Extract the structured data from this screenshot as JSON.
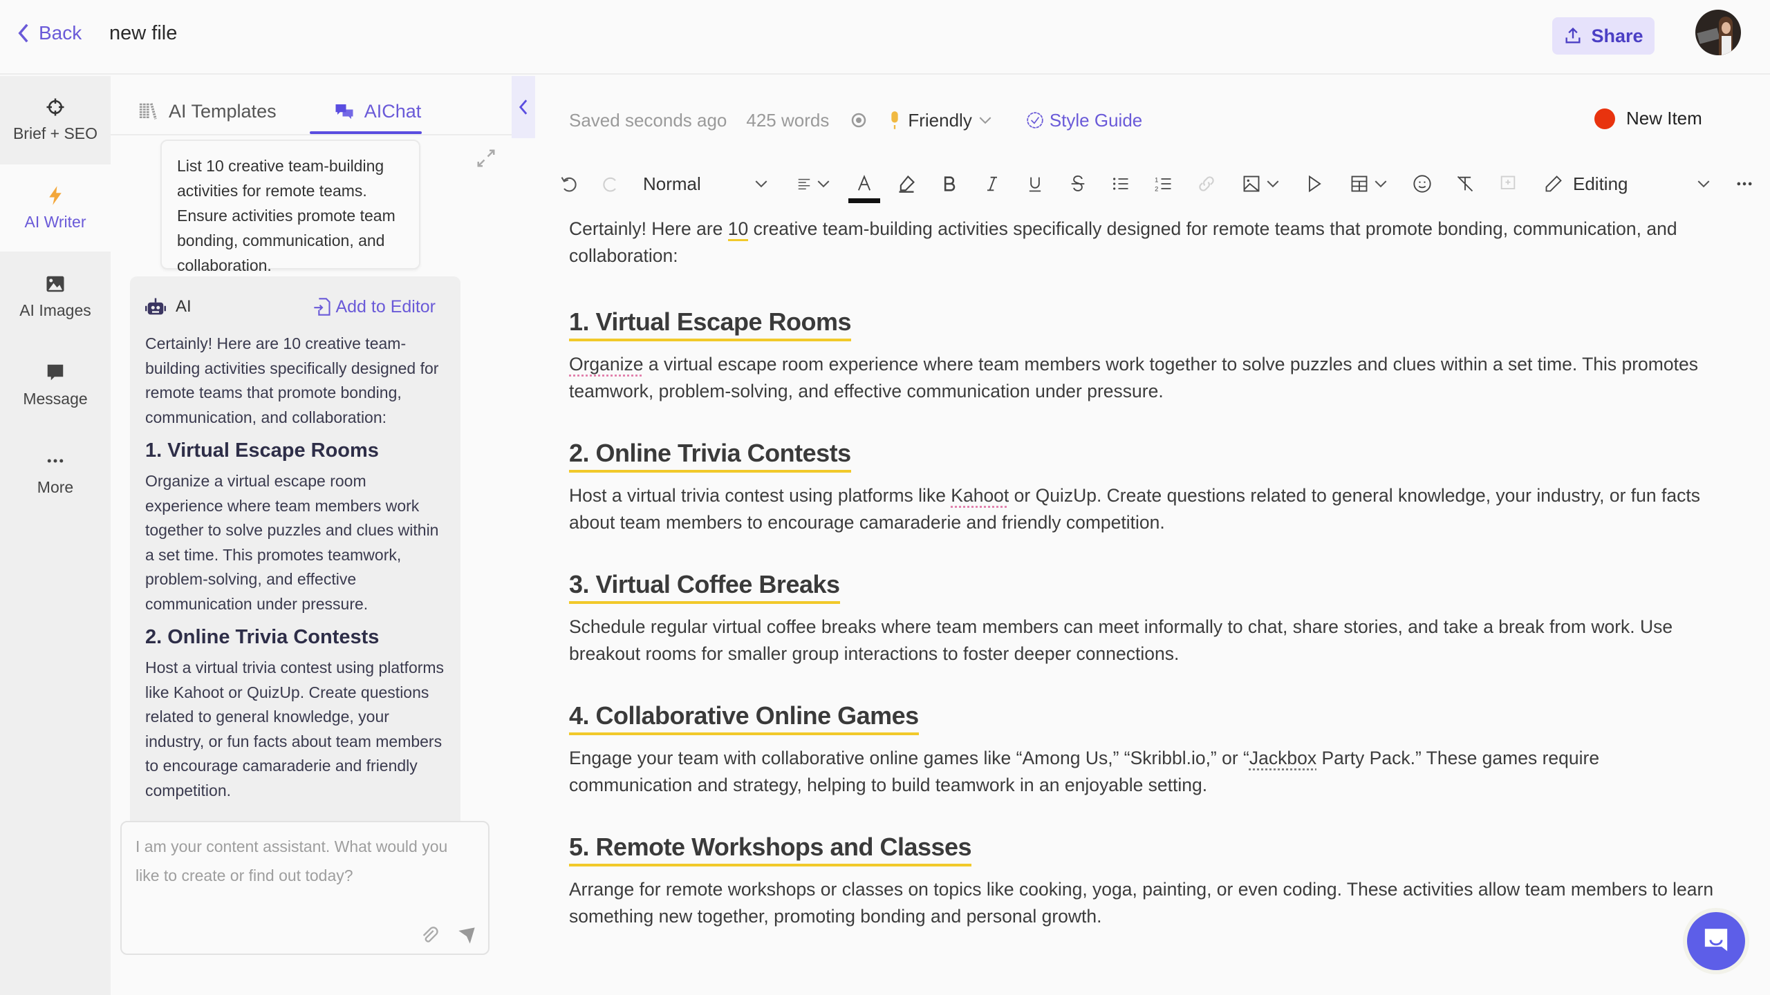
{
  "header": {
    "back_label": "Back",
    "file_title": "new file",
    "share_label": "Share"
  },
  "sidebar": {
    "items": [
      {
        "label": "Brief + SEO",
        "icon": "crosshair-icon"
      },
      {
        "label": "AI Writer",
        "icon": "lightning-icon",
        "active": true
      },
      {
        "label": "AI Images",
        "icon": "image-icon"
      },
      {
        "label": "Message",
        "icon": "message-icon"
      },
      {
        "label": "More",
        "icon": "more-icon"
      }
    ]
  },
  "left_panel": {
    "tabs": [
      {
        "label": "AI Templates",
        "icon": "templates-icon"
      },
      {
        "label": "AIChat",
        "icon": "chat-bubbles-icon",
        "active": true
      }
    ],
    "prompt": "List 10 creative team-building activities for remote teams. Ensure activities promote team bonding, communication, and collaboration.",
    "ai_response": {
      "sender": "AI",
      "add_to_editor": "Add to Editor",
      "intro": "Certainly! Here are 10 creative team-building activities specifically designed for remote teams that promote bonding, communication, and collaboration:",
      "sections": [
        {
          "heading_num": "1.",
          "heading": "Virtual Escape Rooms",
          "body": "Organize a virtual escape room experience where team members work together to solve puzzles and clues within a set time. This promotes teamwork, problem-solving, and effective communication under pressure."
        },
        {
          "heading_num": "2.",
          "heading": "Online Trivia Contests",
          "body": "Host a virtual trivia contest using platforms like Kahoot or QuizUp. Create questions related to general knowledge, your industry, or fun facts about team members to encourage camaraderie and friendly competition."
        }
      ]
    },
    "chat_input_placeholder": "I am your content assistant. What would you like to create or find out today?"
  },
  "status": {
    "saved": "Saved seconds ago",
    "words": "425 words",
    "tone": "Friendly",
    "style_guide": "Style Guide",
    "new_item": "New Item",
    "new_item_color": "#e8330e"
  },
  "toolbar": {
    "block_style": "Normal",
    "mode": "Editing",
    "text_color": "#111111"
  },
  "document": {
    "intro_pre": "Certainly! Here are ",
    "intro_num": "10",
    "intro_post": " creative team-building activities specifically designed for remote teams that promote bonding, communication, and collaboration:",
    "sections": [
      {
        "num": "1.",
        "title": "Virtual Escape Rooms",
        "body_pre": "",
        "body_flag": "Organize",
        "body_post": " a virtual escape room experience where team members work together to solve puzzles and clues within a set time. This promotes teamwork, problem-solving, and effective communication under pressure."
      },
      {
        "num": "2.",
        "title": "Online Trivia Contests",
        "body_pre": "Host a virtual trivia contest using platforms like ",
        "body_flag": "Kahoot",
        "body_post": " or QuizUp. Create questions related to general knowledge, your industry, or fun facts about team members to encourage camaraderie and friendly competition."
      },
      {
        "num": "3.",
        "title": "Virtual Coffee Breaks",
        "body_pre": "Schedule regular virtual coffee breaks where team members can meet informally to chat, share stories, and take a break from work. Use breakout rooms for smaller group interactions to foster deeper connections.",
        "body_flag": "",
        "body_post": ""
      },
      {
        "num": "4.",
        "title": "Collaborative Online Games",
        "body_pre": "Engage your team with collaborative online games like “Among Us,” “Skribbl.io,” or “",
        "body_flag": "Jackbox",
        "body_post": " Party Pack.” These games require communication and strategy, helping to build teamwork in an enjoyable setting."
      },
      {
        "num": "5.",
        "title": "Remote Workshops and Classes",
        "body_pre": "Arrange for remote workshops or classes on topics like cooking, yoga, painting, or even coding. These activities allow team members to learn something new together, promoting bonding and personal growth.",
        "body_flag": "",
        "body_post": ""
      }
    ]
  },
  "colors": {
    "accent": "#6a5ad8",
    "tab_underline": "#5a4de0",
    "heading_underline": "#f1c92a",
    "launcher": "#5d5ee8"
  }
}
